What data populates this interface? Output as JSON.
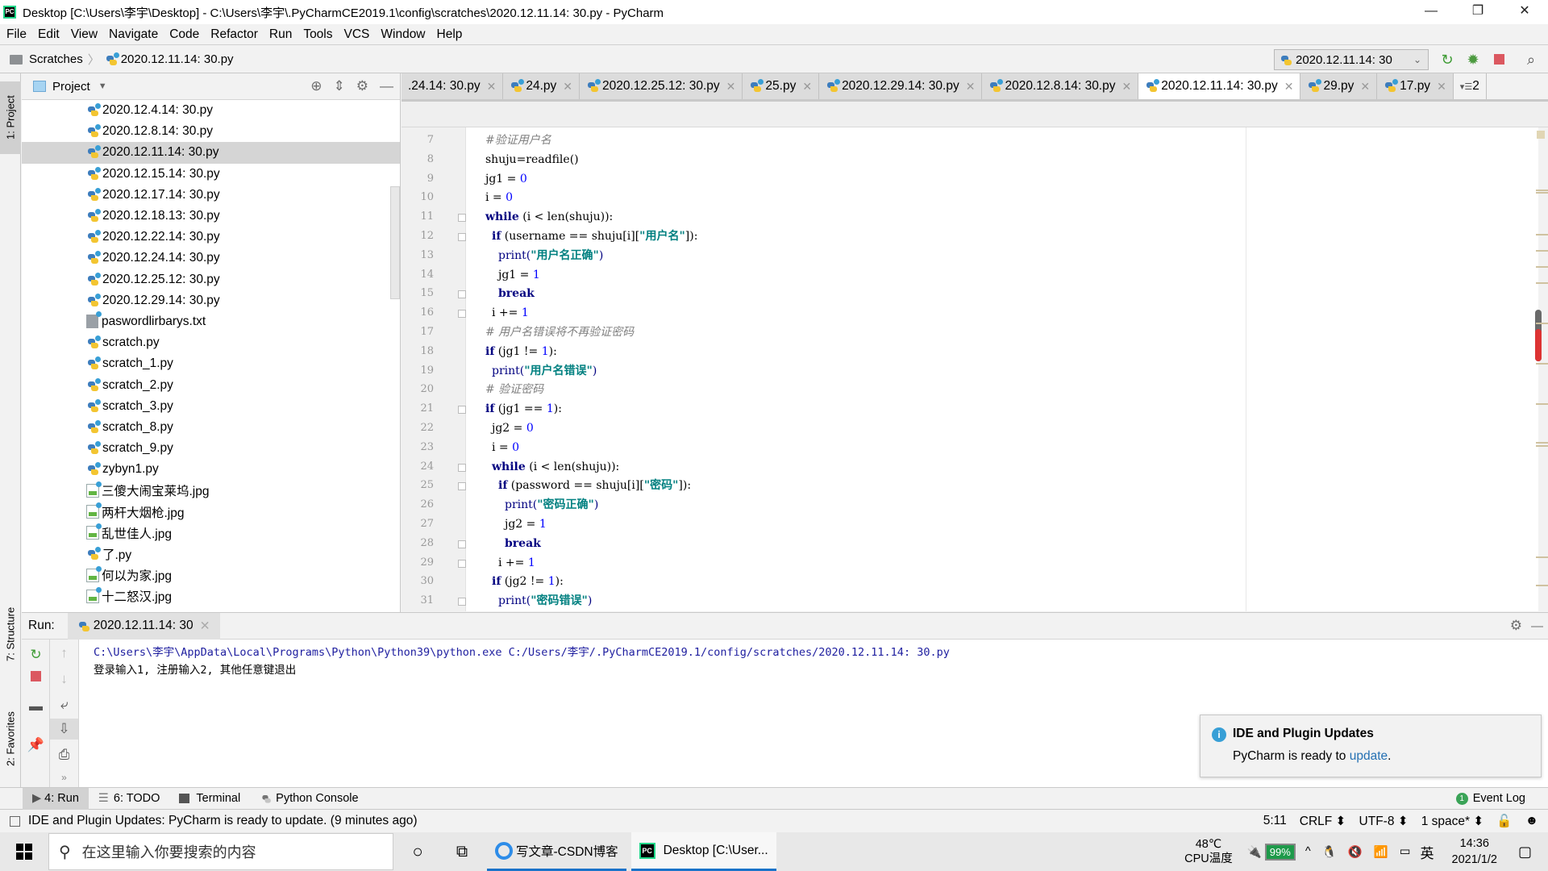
{
  "window": {
    "title": "Desktop [C:\\Users\\李宇\\Desktop] - C:\\Users\\李宇\\.PyCharmCE2019.1\\config\\scratches\\2020.12.11.14: 30.py - PyCharm",
    "controls": {
      "minimize": "—",
      "restore": "❐",
      "close": "✕"
    }
  },
  "menu": [
    "File",
    "Edit",
    "View",
    "Navigate",
    "Code",
    "Refactor",
    "Run",
    "Tools",
    "VCS",
    "Window",
    "Help"
  ],
  "navbar": {
    "crumbs": [
      "Scratches",
      "2020.12.11.14: 30.py"
    ],
    "run_config": "2020.12.11.14: 30",
    "icons": [
      "rerun-icon",
      "debug-icon",
      "stop-icon",
      "search-icon"
    ]
  },
  "left_stripe": {
    "project": "1: Project",
    "structure": "7: Structure",
    "favorites": "2: Favorites"
  },
  "project_panel": {
    "title": "Project",
    "files": [
      {
        "name": "2020.12.4.14: 30.py",
        "type": "py"
      },
      {
        "name": "2020.12.8.14: 30.py",
        "type": "py"
      },
      {
        "name": "2020.12.11.14: 30.py",
        "type": "py",
        "selected": true
      },
      {
        "name": "2020.12.15.14: 30.py",
        "type": "py"
      },
      {
        "name": "2020.12.17.14: 30.py",
        "type": "py"
      },
      {
        "name": "2020.12.18.13: 30.py",
        "type": "py"
      },
      {
        "name": "2020.12.22.14: 30.py",
        "type": "py"
      },
      {
        "name": "2020.12.24.14: 30.py",
        "type": "py"
      },
      {
        "name": "2020.12.25.12: 30.py",
        "type": "py"
      },
      {
        "name": "2020.12.29.14: 30.py",
        "type": "py"
      },
      {
        "name": "paswordlirbarys.txt",
        "type": "txt"
      },
      {
        "name": "scratch.py",
        "type": "py"
      },
      {
        "name": "scratch_1.py",
        "type": "py"
      },
      {
        "name": "scratch_2.py",
        "type": "py"
      },
      {
        "name": "scratch_3.py",
        "type": "py"
      },
      {
        "name": "scratch_8.py",
        "type": "py"
      },
      {
        "name": "scratch_9.py",
        "type": "py"
      },
      {
        "name": "zybyn1.py",
        "type": "py"
      },
      {
        "name": "三傻大闹宝莱坞.jpg",
        "type": "img"
      },
      {
        "name": "两杆大烟枪.jpg",
        "type": "img"
      },
      {
        "name": "乱世佳人.jpg",
        "type": "img"
      },
      {
        "name": "了.py",
        "type": "py"
      },
      {
        "name": "何以为家.jpg",
        "type": "img"
      },
      {
        "name": "十二怒汉.jpg",
        "type": "img"
      }
    ]
  },
  "editor_tabs": [
    {
      "label": ".24.14: 30.py"
    },
    {
      "label": "24.py"
    },
    {
      "label": "2020.12.25.12: 30.py"
    },
    {
      "label": "25.py"
    },
    {
      "label": "2020.12.29.14: 30.py"
    },
    {
      "label": "2020.12.8.14: 30.py"
    },
    {
      "label": "2020.12.11.14: 30.py",
      "active": true
    },
    {
      "label": "29.py"
    },
    {
      "label": "17.py"
    }
  ],
  "tabs_overflow": "2",
  "code": [
    {
      "n": "7",
      "indent": 0,
      "parts": [
        [
          "cm",
          "#验证用户名"
        ]
      ]
    },
    {
      "n": "8",
      "indent": 0,
      "parts": [
        [
          "",
          "shuju=readfile()"
        ]
      ]
    },
    {
      "n": "9",
      "indent": 0,
      "parts": [
        [
          "",
          "jg1 = "
        ],
        [
          "num",
          "0"
        ]
      ]
    },
    {
      "n": "10",
      "indent": 0,
      "parts": [
        [
          "",
          "i = "
        ],
        [
          "num",
          "0"
        ]
      ]
    },
    {
      "n": "11",
      "indent": 0,
      "fold": true,
      "parts": [
        [
          "kw",
          "while"
        ],
        [
          "",
          " (i < len(shuju)):"
        ]
      ]
    },
    {
      "n": "12",
      "indent": 1,
      "fold": true,
      "parts": [
        [
          "kw",
          "if"
        ],
        [
          "",
          " (username == shuju[i]["
        ],
        [
          "str",
          "\"用户名\""
        ],
        [
          "",
          "]):"
        ]
      ]
    },
    {
      "n": "13",
      "indent": 2,
      "parts": [
        [
          "fn",
          "print("
        ],
        [
          "str",
          "\"用户名正确\""
        ],
        [
          "fn",
          ")"
        ]
      ]
    },
    {
      "n": "14",
      "indent": 2,
      "parts": [
        [
          "",
          "jg1 = "
        ],
        [
          "num",
          "1"
        ]
      ]
    },
    {
      "n": "15",
      "indent": 2,
      "fold": true,
      "parts": [
        [
          "kw",
          "break"
        ]
      ]
    },
    {
      "n": "16",
      "indent": 1,
      "fold": true,
      "parts": [
        [
          "",
          "i += "
        ],
        [
          "num",
          "1"
        ]
      ]
    },
    {
      "n": "17",
      "indent": 0,
      "parts": [
        [
          "cm",
          "# 用户名错误将不再验证密码"
        ]
      ]
    },
    {
      "n": "18",
      "indent": 0,
      "parts": [
        [
          "kw",
          "if"
        ],
        [
          "",
          " (jg1 != "
        ],
        [
          "num",
          "1"
        ],
        [
          "",
          "):"
        ]
      ]
    },
    {
      "n": "19",
      "indent": 1,
      "parts": [
        [
          "fn",
          "print("
        ],
        [
          "str",
          "\"用户名错误\""
        ],
        [
          "fn",
          ")"
        ]
      ]
    },
    {
      "n": "20",
      "indent": 0,
      "parts": [
        [
          "cm",
          "# 验证密码"
        ]
      ]
    },
    {
      "n": "21",
      "indent": 0,
      "fold": true,
      "parts": [
        [
          "kw",
          "if"
        ],
        [
          "",
          " (jg1 == "
        ],
        [
          "num",
          "1"
        ],
        [
          "",
          "):"
        ]
      ]
    },
    {
      "n": "22",
      "indent": 1,
      "parts": [
        [
          "",
          "jg2 = "
        ],
        [
          "num",
          "0"
        ]
      ]
    },
    {
      "n": "23",
      "indent": 1,
      "parts": [
        [
          "",
          "i = "
        ],
        [
          "num",
          "0"
        ]
      ]
    },
    {
      "n": "24",
      "indent": 1,
      "fold": true,
      "parts": [
        [
          "kw",
          "while"
        ],
        [
          "",
          " (i < len(shuju)):"
        ]
      ]
    },
    {
      "n": "25",
      "indent": 2,
      "fold": true,
      "parts": [
        [
          "kw",
          "if"
        ],
        [
          "",
          " (password == shuju[i]["
        ],
        [
          "str",
          "\"密码\""
        ],
        [
          "",
          "]):"
        ]
      ]
    },
    {
      "n": "26",
      "indent": 3,
      "parts": [
        [
          "fn",
          "print("
        ],
        [
          "str",
          "\"密码正确\""
        ],
        [
          "fn",
          ")"
        ]
      ]
    },
    {
      "n": "27",
      "indent": 3,
      "parts": [
        [
          "",
          "jg2 = "
        ],
        [
          "num",
          "1"
        ]
      ]
    },
    {
      "n": "28",
      "indent": 3,
      "fold": true,
      "parts": [
        [
          "kw",
          "break"
        ]
      ]
    },
    {
      "n": "29",
      "indent": 2,
      "fold": true,
      "parts": [
        [
          "",
          "i += "
        ],
        [
          "num",
          "1"
        ]
      ]
    },
    {
      "n": "30",
      "indent": 1,
      "parts": [
        [
          "kw",
          "if"
        ],
        [
          "",
          " (jg2 != "
        ],
        [
          "num",
          "1"
        ],
        [
          "",
          "):"
        ]
      ]
    },
    {
      "n": "31",
      "indent": 2,
      "fold": true,
      "parts": [
        [
          "fn",
          "print("
        ],
        [
          "str",
          "\"密码错误\""
        ],
        [
          "fn",
          ")"
        ]
      ]
    }
  ],
  "run_panel": {
    "label": "Run:",
    "tab": "2020.12.11.14: 30",
    "console": [
      "C:\\Users\\李宇\\AppData\\Local\\Programs\\Python\\Python39\\python.exe C:/Users/李宇/.PyCharmCE2019.1/config/scratches/2020.12.11.14: 30.py",
      "登录输入1, 注册输入2, 其他任意键退出"
    ]
  },
  "notification": {
    "title": "IDE and Plugin Updates",
    "body_prefix": "PyCharm is ready to ",
    "link": "update",
    "body_suffix": "."
  },
  "tool_tabs": [
    {
      "label": "4: Run",
      "active": true
    },
    {
      "label": "6: TODO"
    },
    {
      "label": "Terminal"
    },
    {
      "label": "Python Console"
    }
  ],
  "event_log": {
    "count": "1",
    "label": "Event Log"
  },
  "status": {
    "message": "IDE and Plugin Updates: PyCharm is ready to update. (9 minutes ago)",
    "position": "5:11",
    "line_sep": "CRLF ⬍",
    "encoding": "UTF-8 ⬍",
    "indent": "1 space* ⬍"
  },
  "taskbar": {
    "search_placeholder": "在这里输入你要搜索的内容",
    "apps": [
      {
        "label": "写文章-CSDN博客"
      },
      {
        "label": "Desktop [C:\\User...",
        "active": true
      }
    ],
    "cpu_temp": "48℃",
    "cpu_label": "CPU温度",
    "battery": "99%",
    "ime": "英",
    "time": "14:36",
    "date": "2021/1/2"
  }
}
